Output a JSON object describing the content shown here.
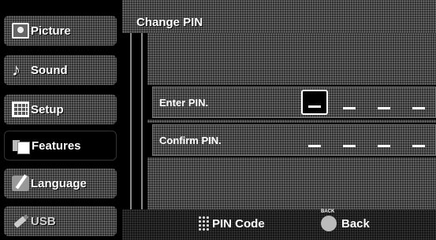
{
  "sidebar": {
    "items": [
      {
        "label": "Picture",
        "icon": "picture-icon"
      },
      {
        "label": "Sound",
        "icon": "sound-icon"
      },
      {
        "label": "Setup",
        "icon": "setup-icon"
      },
      {
        "label": "Features",
        "icon": "features-icon"
      },
      {
        "label": "Language",
        "icon": "language-icon"
      },
      {
        "label": "USB",
        "icon": "usb-icon"
      }
    ]
  },
  "header": {
    "title": "Change PIN"
  },
  "form": {
    "enter_label": "Enter PIN.",
    "confirm_label": "Confirm PIN.",
    "placeholder": "_"
  },
  "footer": {
    "pin_code_label": "PIN Code",
    "back_label": "Back"
  }
}
